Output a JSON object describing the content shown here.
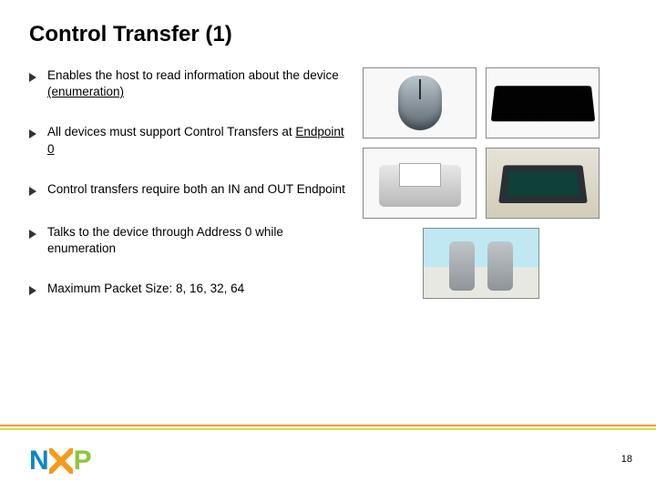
{
  "title": "Control Transfer (1)",
  "bullets": [
    {
      "pre": "Enables the host to read information about the device ",
      "underlined": "(enumeration)",
      "post": ""
    },
    {
      "pre": "All devices must support Control Transfers at ",
      "underlined": "Endpoint 0",
      "post": ""
    },
    {
      "pre": "Control transfers require both an IN and OUT Endpoint",
      "underlined": "",
      "post": ""
    },
    {
      "pre": "Talks to the device through Address 0 while enumeration",
      "underlined": "",
      "post": ""
    },
    {
      "pre": "Maximum Packet Size: 8, 16, 32, 64",
      "underlined": "",
      "post": ""
    }
  ],
  "images": [
    {
      "name": "mouse"
    },
    {
      "name": "keyboard"
    },
    {
      "name": "printer"
    },
    {
      "name": "scanner"
    },
    {
      "name": "speakers"
    }
  ],
  "logo": {
    "n": "N",
    "p": "P"
  },
  "page_number": "18"
}
